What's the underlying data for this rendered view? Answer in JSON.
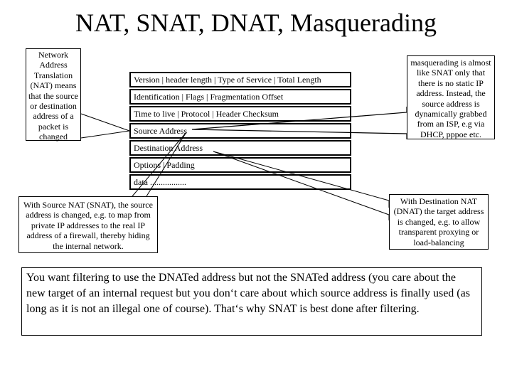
{
  "slide": {
    "title": "NAT, SNAT, DNAT, Masquerading"
  },
  "callouts": {
    "nat": "Network Address Translation (NAT) means that the source or destination address of a packet is changed",
    "masquerading": "masquerading is almost like SNAT only that there is no static IP address. Instead, the source address is dynamically grabbed from an ISP, e.g via DHCP, pppoe etc.",
    "snat": "With Source NAT (SNAT), the source address is changed, e.g. to map from private IP addresses to the real IP address of a firewall, thereby hiding the internal network.",
    "dnat": "With Destination NAT (DNAT) the target address is changed, e.g. to allow transparent proxying or load-balancing"
  },
  "packet_header": {
    "rows": [
      "Version |   header length  | Type of Service  |  Total Length",
      "Identification  |  Flags | Fragmentation Offset",
      "Time to live  |  Protocol  |  Header Checksum",
      "Source Address",
      "Destination Address",
      "Options   |   Padding",
      "data ................."
    ]
  },
  "summary": {
    "text": "You want filtering to use the DNATed address but not the SNATed address (you care about the new target of an internal request but you don‘t care about which source address is finally used (as long as it is not an illegal one of course). That‘s why SNAT is best done after filtering."
  }
}
